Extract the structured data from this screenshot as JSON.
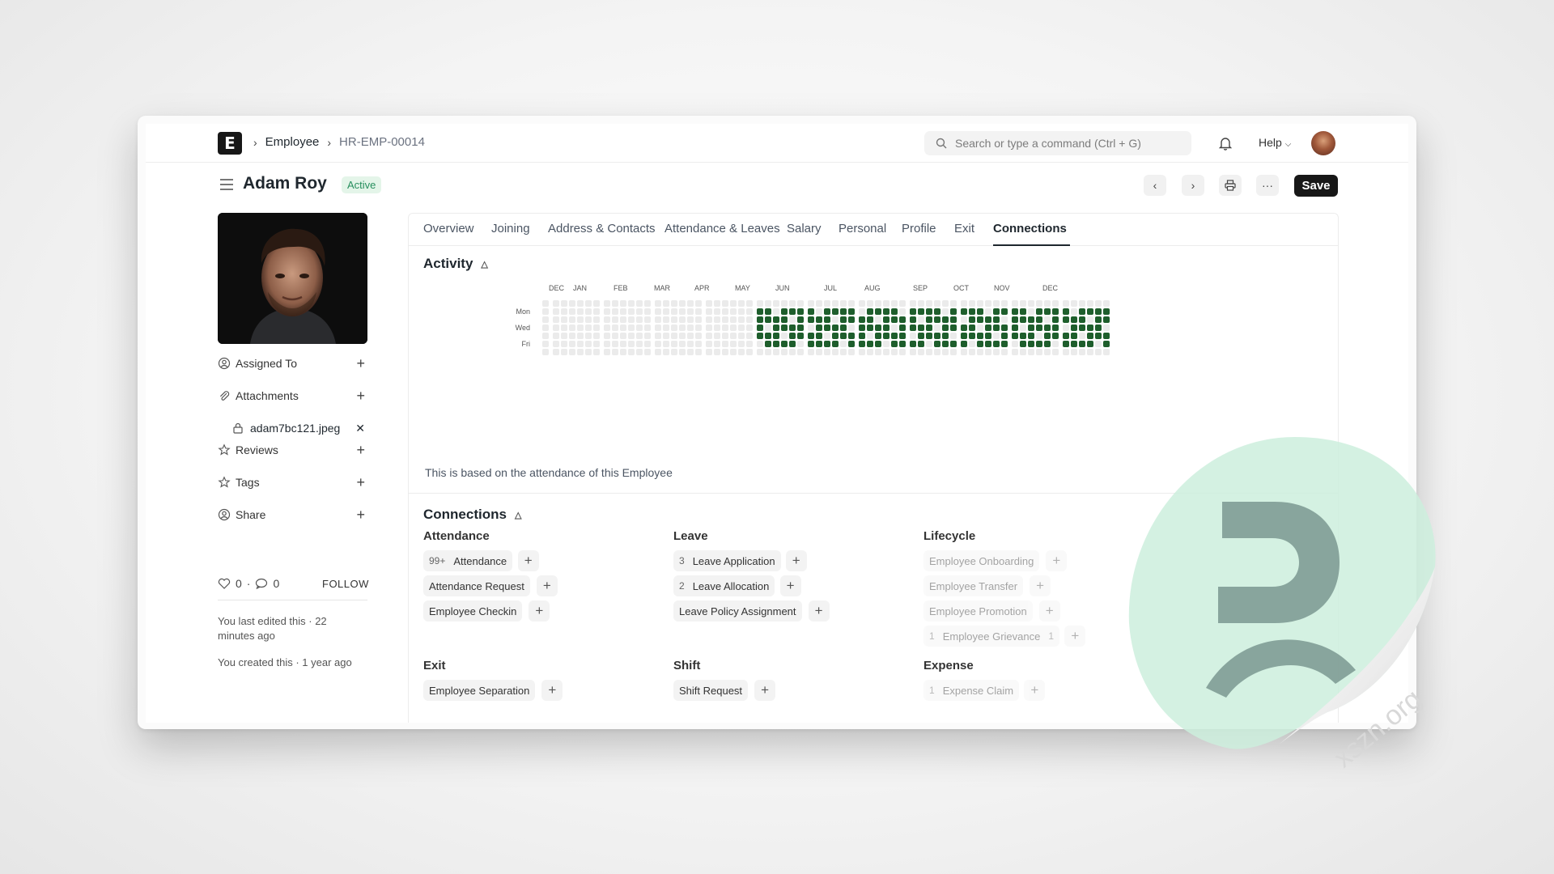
{
  "navbar": {
    "logo": "E",
    "breadcrumb": [
      "Employee",
      "HR-EMP-00014"
    ],
    "search_placeholder": "Search or type a command (Ctrl + G)",
    "help_label": "Help"
  },
  "header": {
    "title": "Adam Roy",
    "status": "Active",
    "save_label": "Save"
  },
  "sidebar": {
    "items": [
      {
        "label": "Assigned To",
        "icon": "user-plus-icon"
      },
      {
        "label": "Attachments",
        "icon": "paperclip-icon"
      },
      {
        "label": "Reviews",
        "icon": "star-icon"
      },
      {
        "label": "Tags",
        "icon": "tag-icon"
      },
      {
        "label": "Share",
        "icon": "share-icon"
      }
    ],
    "attachment_file": "adam7bc121.jpeg",
    "likes": "0",
    "comments": "0",
    "follow_label": "FOLLOW",
    "last_edited": "You last edited this · 22 minutes ago",
    "created": "You created this · 1 year ago"
  },
  "tabs": [
    "Overview",
    "Joining",
    "Address & Contacts",
    "Attendance & Leaves",
    "Salary",
    "Personal",
    "Profile",
    "Exit",
    "Connections"
  ],
  "active_tab": "Connections",
  "activity": {
    "title": "Activity",
    "months": [
      "DEC",
      "JAN",
      "FEB",
      "MAR",
      "APR",
      "MAY",
      "JUN",
      "JUL",
      "AUG",
      "SEP",
      "OCT",
      "NOV",
      "DEC"
    ],
    "days": [
      "Mon",
      "Wed",
      "Fri"
    ],
    "note": "This is based on the attendance of this Employee",
    "active_color": "#1e5e2c",
    "empty_color": "#ebebeb"
  },
  "connections": {
    "title": "Connections",
    "groups": [
      {
        "title": "Attendance",
        "items": [
          {
            "count": "99+",
            "label": "Attendance"
          },
          {
            "count": "",
            "label": "Attendance Request"
          },
          {
            "count": "",
            "label": "Employee Checkin"
          }
        ]
      },
      {
        "title": "Leave",
        "items": [
          {
            "count": "3",
            "label": "Leave Application"
          },
          {
            "count": "2",
            "label": "Leave Allocation"
          },
          {
            "count": "",
            "label": "Leave Policy Assignment"
          }
        ]
      },
      {
        "title": "Lifecycle",
        "items": [
          {
            "count": "",
            "label": "Employee Onboarding"
          },
          {
            "count": "",
            "label": "Employee Transfer"
          },
          {
            "count": "",
            "label": "Employee Promotion"
          },
          {
            "count": "1",
            "label": "Employee Grievance",
            "extra": "1"
          }
        ]
      },
      {
        "title": "Exit",
        "items": [
          {
            "count": "",
            "label": "Employee Separation"
          }
        ]
      },
      {
        "title": "Shift",
        "items": [
          {
            "count": "",
            "label": "Shift Request"
          }
        ]
      },
      {
        "title": "Expense",
        "items": [
          {
            "count": "1",
            "label": "Expense Claim"
          }
        ]
      }
    ]
  },
  "watermark": "xszn.org"
}
